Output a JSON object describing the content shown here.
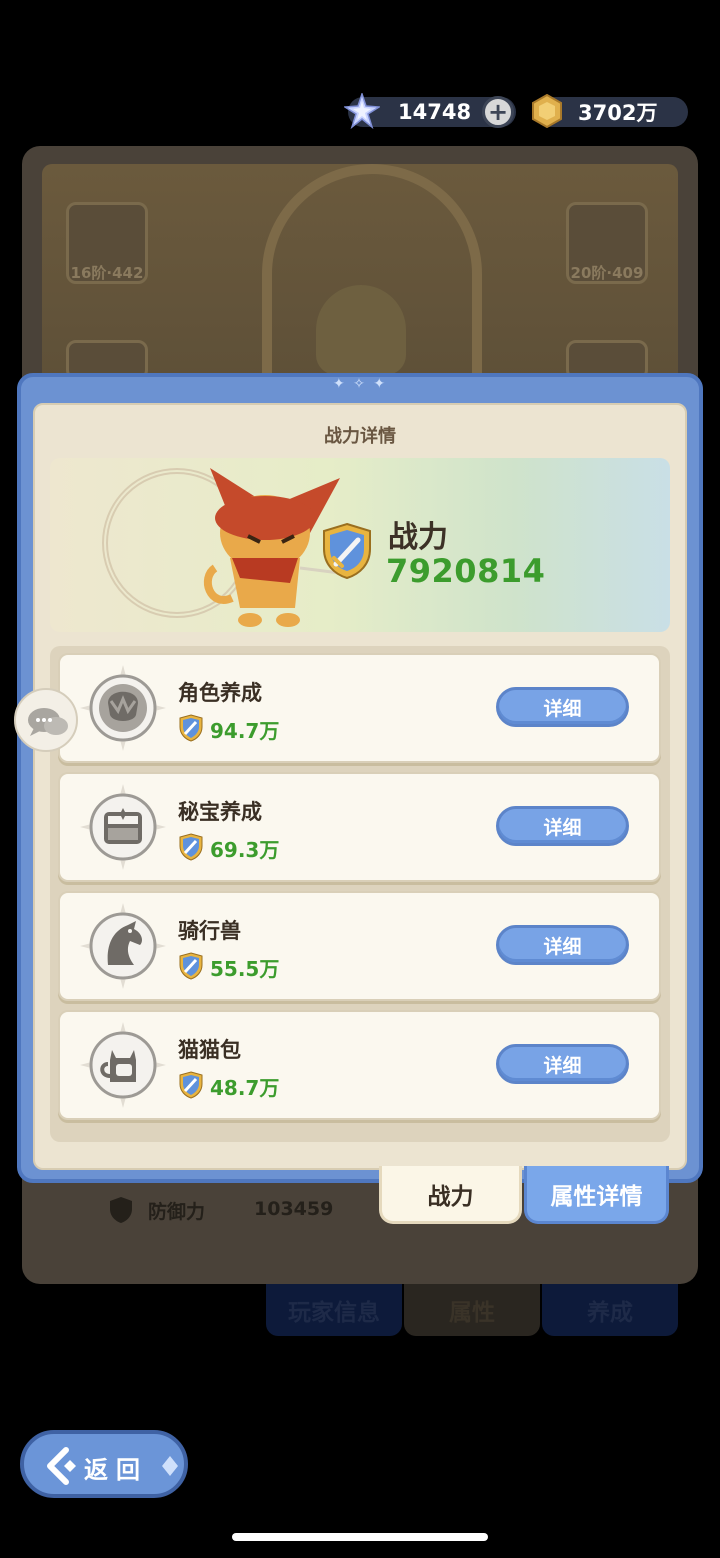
{
  "currency": {
    "gems": "14748",
    "plus": "+",
    "gold": "3702万"
  },
  "background": {
    "slot_left_label": "16阶·442",
    "slot_right_label": "20阶·409",
    "defense_label": "防御力",
    "defense_value": "103459",
    "tabs": [
      "玩家信息",
      "属性",
      "养成"
    ]
  },
  "popup": {
    "title": "战力详情",
    "power_label": "战力",
    "power_value": "7920814",
    "rows": [
      {
        "name": "角色养成",
        "value": "94.7万",
        "button": "详细",
        "icon": "character-icon"
      },
      {
        "name": "秘宝养成",
        "value": "69.3万",
        "button": "详细",
        "icon": "treasure-icon"
      },
      {
        "name": "骑行兽",
        "value": "55.5万",
        "button": "详细",
        "icon": "mount-horse-icon"
      },
      {
        "name": "猫猫包",
        "value": "48.7万",
        "button": "详细",
        "icon": "cat-bag-icon"
      }
    ],
    "tab_power": "战力",
    "tab_attributes": "属性详情"
  },
  "back_button": "返回",
  "colors": {
    "power_green": "#3c9c2d",
    "popup_blue": "#6c92d2",
    "button_blue": "#78a3e6"
  }
}
